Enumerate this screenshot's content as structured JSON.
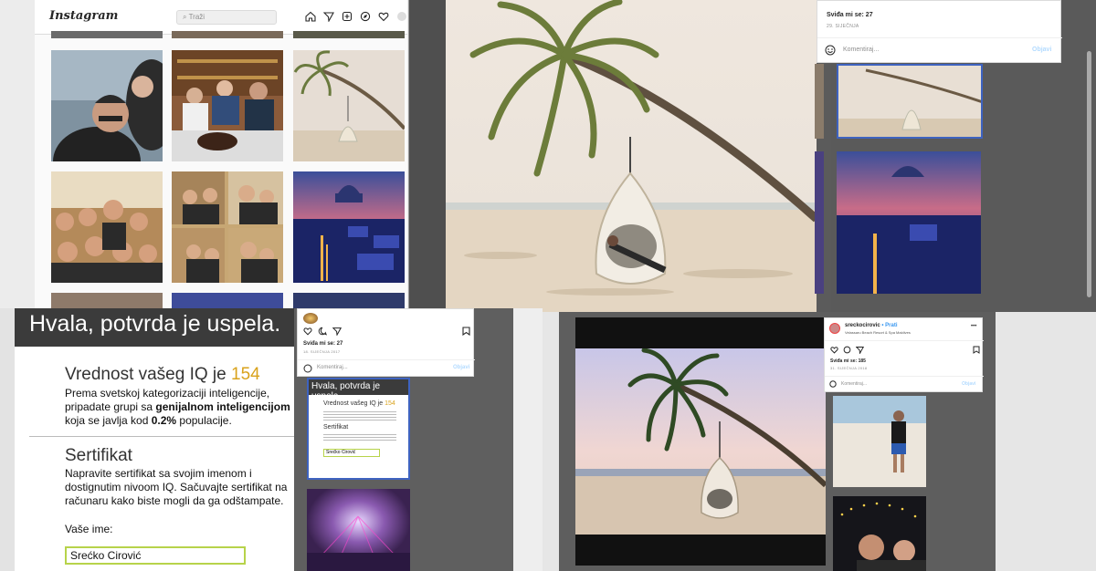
{
  "instagram_grid": {
    "logo": "Instagram",
    "search_placeholder": "Traži",
    "icons": [
      "home-icon",
      "direct-icon",
      "new-post-icon",
      "explore-icon",
      "heart-icon",
      "profile-icon"
    ]
  },
  "viewer_top": {
    "likes": "Sviđa mi se: 27",
    "date": "29. SIJEČNJA",
    "comment_placeholder": "Komentiraj...",
    "post_label": "Objavi"
  },
  "iq_page": {
    "banner": "Hvala, potvrda je uspela.",
    "iq_title": "Vrednost vašeg IQ je",
    "iq_value": "154",
    "iq_text_1": "Prema svetskoj kategorizaciji inteligencije,",
    "iq_text_2a": "pripadate grupi sa ",
    "iq_text_2b": "genijalnom inteligencijom",
    "iq_text_3a": "koja se javlja kod ",
    "iq_text_3b": "0.2%",
    "iq_text_3c": " populacije.",
    "cert_title": "Sertifikat",
    "cert_text_1": "Napravite sertifikat sa svojim imenom i",
    "cert_text_2": "dostignutim nivoom IQ. Sačuvajte sertifikat na",
    "cert_text_3": "računaru kako biste mogli da ga odštampate.",
    "name_label": "Vaše ime:",
    "name_value": "Srećko Cirović"
  },
  "middle_card": {
    "likes": "Sviđa mi se: 27",
    "date": "18. SIJEČNJA 2017",
    "comment_placeholder": "Komentiraj...",
    "post_label": "Objavi",
    "mini_banner": "Hvala, potvrda je uspela.",
    "mini_iq_title": "Vrednost vašeg IQ je",
    "mini_iq_value": "154",
    "mini_cert_title": "Sertifikat",
    "mini_name": "Srećko Cirović"
  },
  "bottom_card": {
    "username": "sreckocirovic",
    "follow": "• Prati",
    "location": "Velassaru Beach Resort & Spa Maldives",
    "likes": "Sviđa mi se: 185",
    "date": "31. SIJEČNJA 2018",
    "comment_placeholder": "Komentiraj...",
    "post_label": "Objavi"
  },
  "colors": {
    "iq_accent": "#d9a21b",
    "link": "#b3dbff",
    "banner": "#3b3b3b",
    "input_border": "#b7d34a"
  }
}
